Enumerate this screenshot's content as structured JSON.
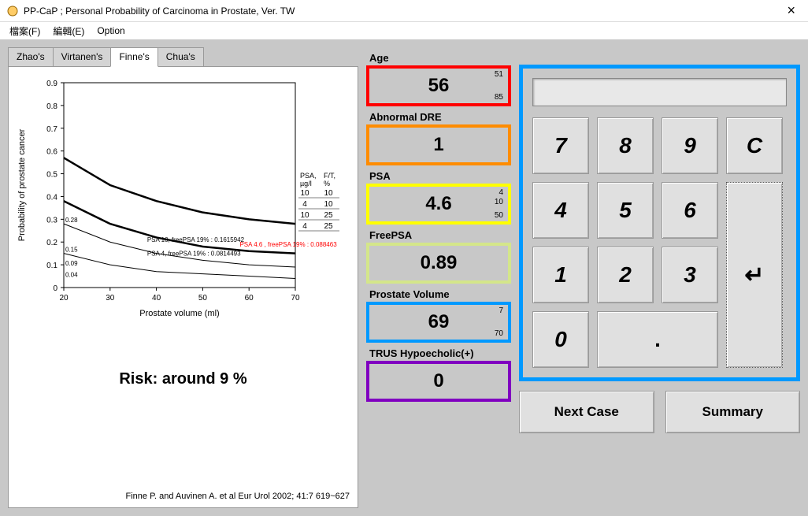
{
  "window": {
    "title": "PP-CaP ; Personal Probability of Carcinoma in Prostate, Ver. TW",
    "close": "×"
  },
  "menu": {
    "file": "檔案(F)",
    "edit": "編輯(E)",
    "option": "Option"
  },
  "tabs": {
    "zhao": "Zhao's",
    "virtanen": "Virtanen's",
    "finne": "Finne's",
    "chua": "Chua's"
  },
  "chart_data": {
    "type": "line",
    "title": "",
    "xlabel": "Prostate volume (ml)",
    "ylabel": "Probability of prostate cancer",
    "xlim": [
      20,
      70
    ],
    "ylim": [
      0,
      0.9
    ],
    "xticks": [
      20,
      30,
      40,
      50,
      60,
      70
    ],
    "yticks": [
      0,
      0.1,
      0.2,
      0.3,
      0.4,
      0.5,
      0.6,
      0.7,
      0.8,
      0.9
    ],
    "legend_cols": [
      {
        "header": "PSA, µg/l",
        "values": [
          10,
          4,
          10,
          4
        ]
      },
      {
        "header": "F/T, %",
        "values": [
          10,
          10,
          25,
          25
        ]
      }
    ],
    "series": [
      {
        "name": "PSA 10 F/T 10",
        "x": [
          20,
          30,
          40,
          50,
          60,
          70
        ],
        "y": [
          0.57,
          0.45,
          0.38,
          0.33,
          0.3,
          0.28
        ],
        "bold": true
      },
      {
        "name": "PSA 4 F/T 10",
        "x": [
          20,
          30,
          40,
          50,
          60,
          70
        ],
        "y": [
          0.38,
          0.28,
          0.22,
          0.18,
          0.16,
          0.15
        ],
        "bold": true
      },
      {
        "name": "PSA 10 F/T 25",
        "x": [
          20,
          30,
          40,
          50,
          60,
          70
        ],
        "y": [
          0.28,
          0.2,
          0.15,
          0.12,
          0.1,
          0.09
        ]
      },
      {
        "name": "PSA 4 F/T 25",
        "x": [
          20,
          30,
          40,
          50,
          60,
          70
        ],
        "y": [
          0.15,
          0.1,
          0.07,
          0.06,
          0.05,
          0.04
        ]
      }
    ],
    "left_labels": [
      {
        "y": 0.28,
        "text": "0.28"
      },
      {
        "y": 0.15,
        "text": "0.15"
      },
      {
        "y": 0.09,
        "text": "0.09"
      },
      {
        "y": 0.04,
        "text": "0.04"
      }
    ],
    "annotations": [
      {
        "text": "PSA 10, freePSA 19% : 0.1615942",
        "x": 38,
        "y": 0.2
      },
      {
        "text": "PSA 4, freePSA 19% : 0.0814493",
        "x": 38,
        "y": 0.14
      },
      {
        "text": "PSA 4.6 , freePSA 19% : 0.088463",
        "x": 58,
        "y": 0.18,
        "color": "red"
      }
    ]
  },
  "risk_text": "Risk:  around  9 %",
  "citation": "Finne P. and Auvinen A. et al   Eur Urol  2002; 41:7 619~627",
  "inputs": {
    "age": {
      "label": "Age",
      "value": "56",
      "min": "51",
      "max": "85"
    },
    "dre": {
      "label": "Abnormal DRE",
      "value": "1"
    },
    "psa": {
      "label": "PSA",
      "value": "4.6",
      "min": "4",
      "mid": "10",
      "max": "50"
    },
    "fpsa": {
      "label": "FreePSA",
      "value": "0.89"
    },
    "pv": {
      "label": "Prostate Volume",
      "value": "69",
      "min": "7",
      "max": "70"
    },
    "trus": {
      "label": "TRUS Hypoecholic(+)",
      "value": "0"
    }
  },
  "calculator": {
    "display": "",
    "keys": {
      "7": "7",
      "8": "8",
      "9": "9",
      "c": "C",
      "4": "4",
      "5": "5",
      "6": "6",
      "1": "1",
      "2": "2",
      "3": "3",
      "0": "0",
      "dot": ".",
      "enter": "↵"
    }
  },
  "actions": {
    "next": "Next Case",
    "summary": "Summary"
  }
}
